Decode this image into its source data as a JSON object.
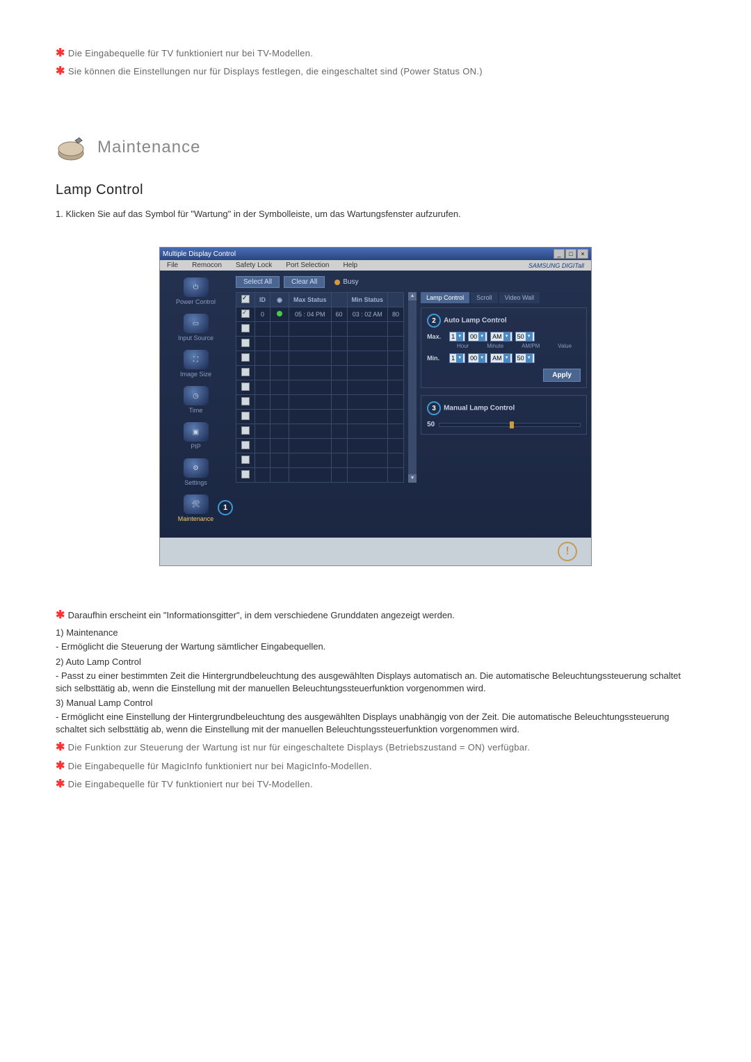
{
  "notes_top": [
    "Die Eingabequelle für TV funktioniert nur bei TV-Modellen.",
    "Sie können die Einstellungen nur für Displays festlegen, die eingeschaltet sind (Power Status ON.)"
  ],
  "section_title": "Maintenance",
  "sub_title": "Lamp Control",
  "step1": "Klicken Sie auf das Symbol für \"Wartung\" in der Symbolleiste, um das Wartungsfenster aufzurufen.",
  "app": {
    "title": "Multiple Display Control",
    "menu": [
      "File",
      "Remocon",
      "Safety Lock",
      "Port Selection",
      "Help"
    ],
    "brand": "SAMSUNG DIGITall",
    "select_all": "Select All",
    "clear_all": "Clear All",
    "busy": "Busy",
    "sidebar": [
      {
        "label": "Power Control"
      },
      {
        "label": "Input Source"
      },
      {
        "label": "Image Size"
      },
      {
        "label": "Time"
      },
      {
        "label": "PIP"
      },
      {
        "label": "Settings"
      },
      {
        "label": "Maintenance",
        "active": true
      }
    ],
    "table": {
      "headers": [
        "ID",
        "",
        "Max Status",
        "",
        "Min Status",
        ""
      ],
      "row": {
        "id": "0",
        "max": "05 : 04 PM",
        "max_pct": "60",
        "min": "03 : 02 AM",
        "min_pct": "80"
      }
    },
    "tabs": [
      {
        "label": "Lamp Control",
        "active": true
      },
      {
        "label": "Scroll"
      },
      {
        "label": "Video Wall"
      }
    ],
    "auto_lamp": {
      "title": "Auto Lamp Control",
      "max_label": "Max.",
      "min_label": "Min.",
      "hour_lbl": "Hour",
      "minute_lbl": "Minute",
      "ampm_lbl": "AM/PM",
      "value_lbl": "Value",
      "max": {
        "hour": "1",
        "min": "00",
        "ampm": "AM",
        "val": "50"
      },
      "min": {
        "hour": "1",
        "min": "00",
        "ampm": "AM",
        "val": "50"
      },
      "apply": "Apply"
    },
    "manual_lamp": {
      "title": "Manual Lamp Control",
      "value": "50"
    }
  },
  "desc": {
    "intro": "Daraufhin erscheint ein \"Informationsgitter\", in dem verschiedene Grunddaten angezeigt werden.",
    "items": [
      {
        "n": "1)",
        "title": "Maintenance",
        "body": "- Ermöglicht die Steuerung der Wartung sämtlicher Eingabequellen."
      },
      {
        "n": "2)",
        "title": "Auto Lamp Control",
        "body": "- Passt zu einer bestimmten Zeit die Hintergrundbeleuchtung des ausgewählten Displays automatisch an. Die automatische Beleuchtungssteuerung schaltet sich selbsttätig ab, wenn die Einstellung mit der manuellen Beleuchtungssteuerfunktion vorgenommen wird."
      },
      {
        "n": "3)",
        "title": "Manual Lamp Control",
        "body": "- Ermöglicht eine Einstellung der Hintergrundbeleuchtung des ausgewählten Displays unabhängig von der Zeit. Die automatische Beleuchtungssteuerung schaltet sich selbsttätig ab, wenn die Einstellung mit der manuellen Beleuchtungssteuerfunktion vorgenommen wird."
      }
    ]
  },
  "notes_bottom": [
    "Die Funktion zur Steuerung der Wartung ist nur für eingeschaltete Displays (Betriebszustand = ON) verfügbar.",
    "Die Eingabequelle für MagicInfo funktioniert nur bei MagicInfo-Modellen.",
    "Die Eingabequelle für TV funktioniert nur bei TV-Modellen."
  ]
}
